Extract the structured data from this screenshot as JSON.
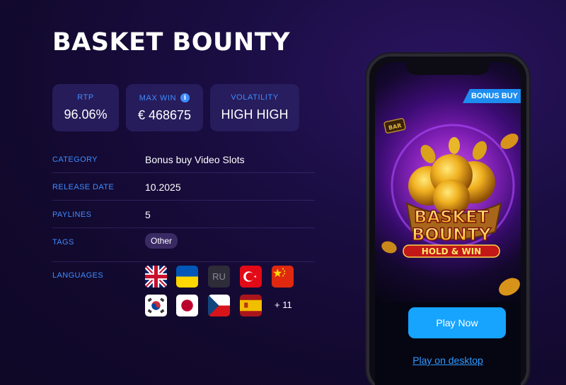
{
  "game": {
    "title": "BASKET BOUNTY"
  },
  "stats": {
    "rtp_label": "RTP",
    "rtp_value": "96.06%",
    "maxwin_label": "MAX WIN",
    "maxwin_info": "i",
    "maxwin_value": "€ 468675",
    "volatility_label": "VOLATILITY",
    "volatility_value": "HIGH HIGH"
  },
  "details": {
    "category_label": "CATEGORY",
    "category_value": "Bonus buy Video Slots",
    "release_label": "RELEASE DATE",
    "release_value": "10.2025",
    "paylines_label": "PAYLINES",
    "paylines_value": "5",
    "tags_label": "TAGS",
    "tags": [
      "Other"
    ],
    "languages_label": "LANGUAGES",
    "languages": [
      "English",
      "Ukrainian",
      "RU",
      "Turkish",
      "Chinese",
      "Korean",
      "Japanese",
      "Czech",
      "Spanish"
    ],
    "languages_more": "+ 11"
  },
  "phone": {
    "badge": "BONUS BUY",
    "logo_line1": "BASKET",
    "logo_line2": "BOUNTY",
    "logo_line3": "HOLD & WIN",
    "bar_symbol": "BAR",
    "play_now": "Play Now",
    "play_desktop": "Play on desktop"
  },
  "colors": {
    "accent": "#3f8cff",
    "play_button": "#17a4ff",
    "badge": "#1d8df0"
  }
}
